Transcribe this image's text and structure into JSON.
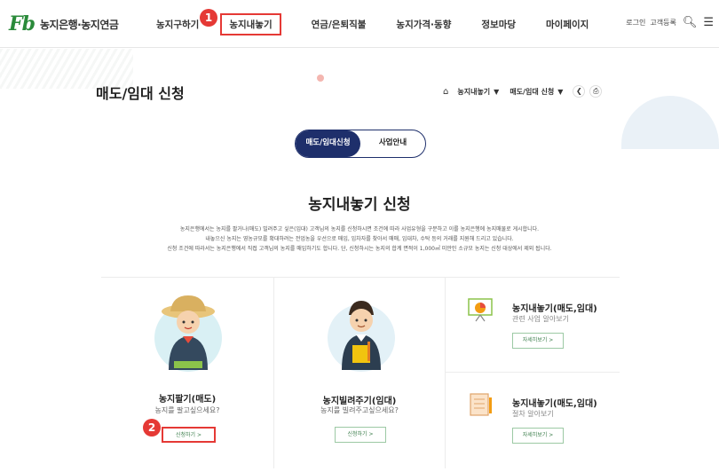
{
  "header": {
    "logo_mark": "Fb",
    "logo_text": "농지은행·농지연금",
    "nav": [
      "농지구하기",
      "농지내놓기",
      "연금/은퇴직불",
      "농지가격·동향",
      "정보마당",
      "마이페이지"
    ],
    "util": {
      "login": "로그인",
      "signup": "고객등록"
    }
  },
  "annotations": {
    "step1": "1",
    "step2": "2"
  },
  "page": {
    "title": "매도/임대 신청",
    "breadcrumb": [
      "농지내놓기",
      "매도/임대 신청"
    ]
  },
  "tabs": [
    "매도/임대신청",
    "사업안내"
  ],
  "section": {
    "title": "농지내놓기 신청",
    "desc": [
      "농지은행에서는 농지를 팔거나(매도) 빌려주고 싶은(임대) 고객님의 농지를 신청하시면 조건에 따라 사업유형을 구분하고 이를 농지은행에 농지매물로 게시합니다.",
      "내놓으신 농지는 영농규모를 확대하려는 전업농을 우선으로 매입, 임차자를 찾아서 매매, 임대차, 수탁 등의 거래를 지원해 드리고 있습니다.",
      "신청 조건에 따라서는 농지은행에서 직접 고객님의 농지를 매입하기도 합니다. 단, 신청하시는 농지의 합계 면적이 1,000㎡ 미만인 소규모 농지는 신청 대상에서 제외 됩니다."
    ]
  },
  "cards": [
    {
      "title": "농지팔기(매도)",
      "sub": "농지를 팔고싶으세요?",
      "button": "신청하기 >"
    },
    {
      "title": "농지빌려주기(임대)",
      "sub": "농지를 빌려주고싶으세요?",
      "button": "신청하기 >"
    }
  ],
  "info": [
    {
      "title": "농지내놓기(매도,임대)",
      "sub": "관련 사업 알아보기",
      "button": "자세히보기 >"
    },
    {
      "title": "농지내놓기(매도,임대)",
      "sub": "절차 알아보기",
      "button": "자세히보기 >"
    }
  ],
  "colors": {
    "navy": "#1e2f6b",
    "red_annotation": "#e53935",
    "green_button": "#3a7d4a"
  }
}
